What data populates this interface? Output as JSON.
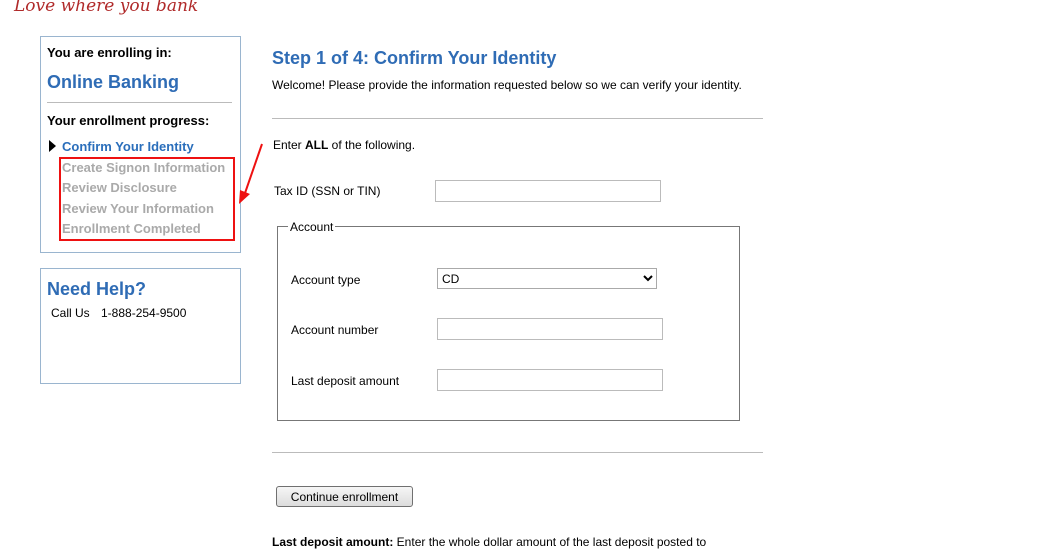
{
  "brand": {
    "slogan": "Love where you bank"
  },
  "sidebar": {
    "enrolling_label": "You are enrolling in:",
    "product": "Online Banking",
    "progress_label": "Your enrollment progress:",
    "steps": [
      {
        "label": "Confirm Your Identity",
        "current": true
      },
      {
        "label": "Create Signon Information",
        "current": false
      },
      {
        "label": "Review Disclosure",
        "current": false
      },
      {
        "label": "Review Your Information",
        "current": false
      },
      {
        "label": "Enrollment Completed",
        "current": false
      }
    ],
    "highlight_color": "#ee1111"
  },
  "help": {
    "title": "Need Help?",
    "call_label": "Call Us",
    "phone": "1-888-254-9500"
  },
  "main": {
    "title": "Step 1 of 4: Confirm Your Identity",
    "intro": "Welcome! Please provide the information requested below so we can verify your identity.",
    "instruction_prefix": "Enter ",
    "instruction_bold": "ALL",
    "instruction_suffix": " of the following.",
    "tax_id_label": "Tax ID (SSN or TIN)",
    "tax_id_value": "",
    "account_legend": "Account",
    "account_type_label": "Account type",
    "account_type_value": "CD",
    "account_number_label": "Account number",
    "account_number_value": "",
    "last_deposit_label": "Last deposit amount",
    "last_deposit_value": "",
    "continue_button": "Continue enrollment",
    "footnote_bold": "Last deposit amount:",
    "footnote": " Enter the whole dollar amount of the last deposit posted to"
  }
}
